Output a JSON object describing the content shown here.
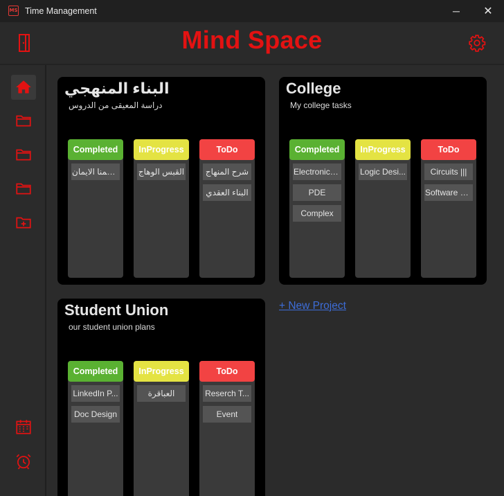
{
  "window": {
    "title": "Time Management",
    "app_icon_text": "MS",
    "minimize_glyph": "─",
    "close_glyph": "✕"
  },
  "header": {
    "brand": "Mind Space",
    "left_icon": "door-icon",
    "right_icon": "gear-icon"
  },
  "colors": {
    "accent": "#e31212",
    "completed": "#5ab132",
    "inprogress": "#e4e343",
    "todo": "#f24343",
    "link": "#3d6dd8"
  },
  "sidebar": {
    "top_items": [
      "home-icon",
      "folder-icon",
      "folder-icon",
      "folder-icon",
      "folder-add-icon"
    ],
    "bottom_items": [
      "calendar-icon",
      "alarm-icon"
    ]
  },
  "projects": [
    {
      "title": "البناء المنهجي",
      "description": "دراسة المعيقى من الدروس",
      "columns": [
        {
          "label": "Completed",
          "tasks": [
            "فحطمنا الايمان"
          ]
        },
        {
          "label": "InProgress",
          "tasks": [
            "القبس الوهاج"
          ]
        },
        {
          "label": "ToDo",
          "tasks": [
            "شرح المنهاج",
            "البناء العقدي"
          ]
        }
      ]
    },
    {
      "title": "College",
      "description": "My college tasks",
      "columns": [
        {
          "label": "Completed",
          "tasks": [
            "Electronics ||",
            "PDE",
            "Complex"
          ]
        },
        {
          "label": "InProgress",
          "tasks": [
            "Logic Desi..."
          ]
        },
        {
          "label": "ToDo",
          "tasks": [
            "Circuits |||",
            "Software E..."
          ]
        }
      ]
    },
    {
      "title": "Student Union",
      "description": "our student union plans",
      "columns": [
        {
          "label": "Completed",
          "tasks": [
            "LinkedIn P...",
            "Doc Design"
          ]
        },
        {
          "label": "InProgress",
          "tasks": [
            "العباقرة"
          ]
        },
        {
          "label": "ToDo",
          "tasks": [
            "Reserch T...",
            "Event"
          ]
        }
      ]
    }
  ],
  "new_project_link": "+ New Project"
}
